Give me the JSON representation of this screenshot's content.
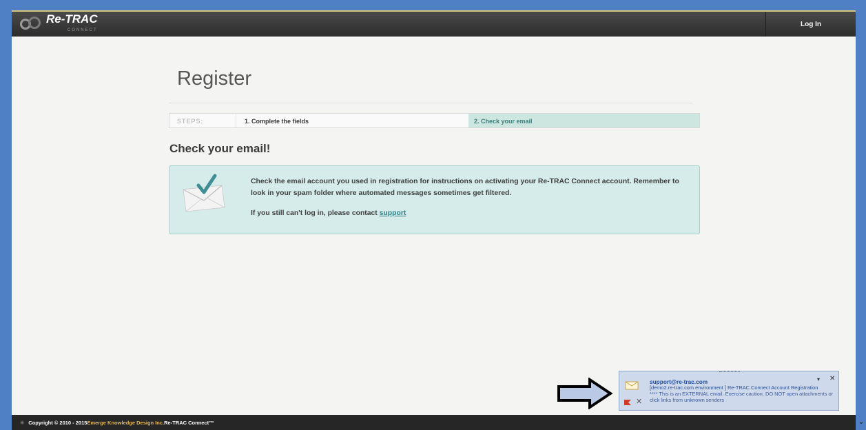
{
  "header": {
    "logo_text": "Re-TRAC",
    "logo_subtext": "CONNECT",
    "login_label": "Log In"
  },
  "page": {
    "title": "Register",
    "steps_label": "STEPS:",
    "steps": [
      {
        "label": "1. Complete the fields",
        "active": false
      },
      {
        "label": "2. Check your email",
        "active": true
      }
    ],
    "heading": "Check your email!",
    "message": "Check the email account you used in registration for instructions on activating your Re-TRAC Connect account. Remember to look in your spam folder where automated messages sometimes get filtered.",
    "contact_prefix": "If you still can't log in, please contact ",
    "contact_link": "support"
  },
  "footer": {
    "copyright": "Copyright © 2010 - 2015 ",
    "company": "Emerge Knowledge Design Inc.",
    "product": " Re-TRAC Connect™"
  },
  "notification": {
    "from": "support@re-trac.com",
    "subject": "[demo2.re-trac.com environment ] Re-TRAC Connect Account Registration",
    "body": "**** This is an EXTERNAL email. Exercise caution. DO NOT open attachments or click links from unknown senders"
  },
  "colors": {
    "accent": "#cde7e0",
    "info_box": "#d5ecea",
    "link": "#2f7e84",
    "header": "#2c2c2c"
  },
  "icons": [
    "re-trac-logo",
    "envelope-check-icon",
    "arrow-right-icon",
    "mail-icon",
    "close-icon",
    "flag-icon",
    "delete-icon",
    "chevron-down-icon"
  ]
}
